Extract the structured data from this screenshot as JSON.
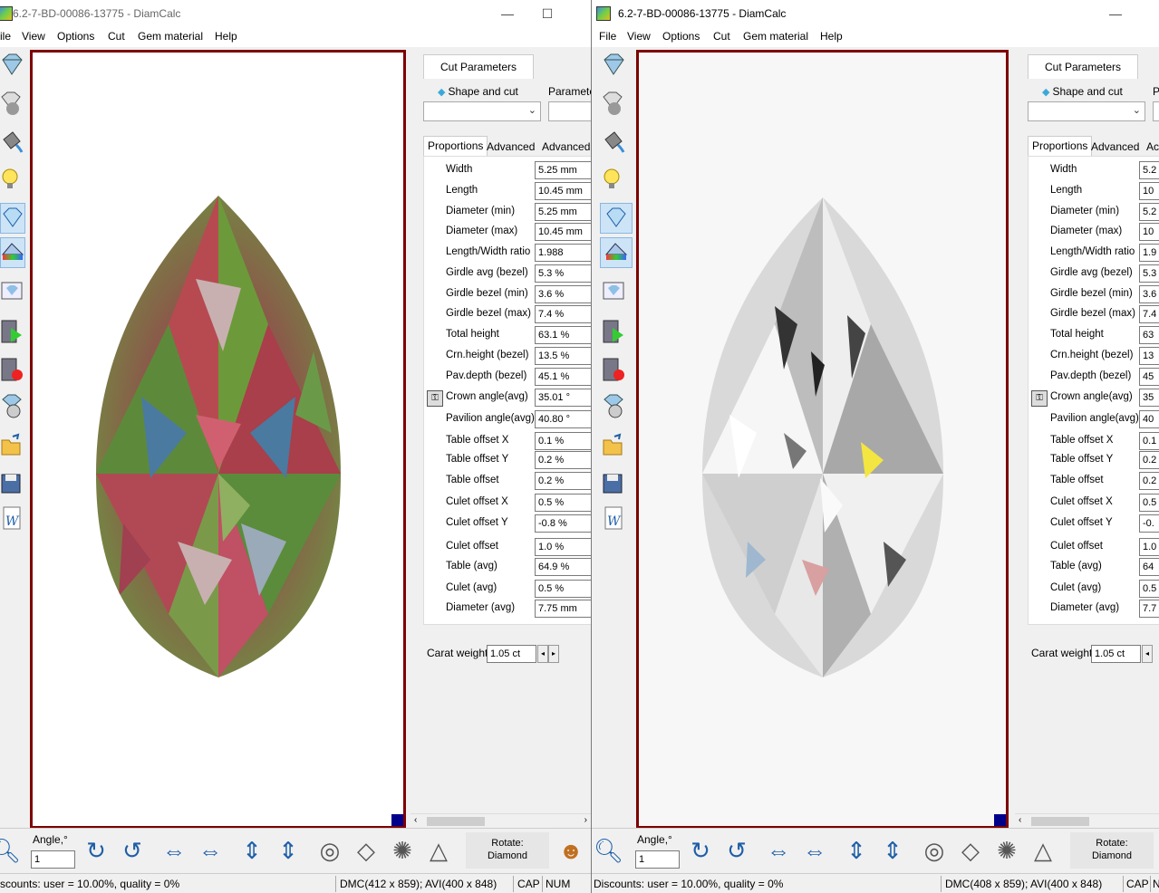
{
  "windows": [
    {
      "title": "6.2-7-BD-00086-13775 - DiamCalc",
      "menu": [
        "ile",
        "View",
        "Options",
        "Cut",
        "Gem material",
        "Help"
      ],
      "controls": [
        "—",
        "☐"
      ],
      "panel": {
        "tab": "Cut Parameters",
        "shape_label": "Shape and cut",
        "param_label": "Parameter",
        "subtabs": [
          "Proportions",
          "Advanced",
          "Advanced"
        ],
        "proportions": [
          {
            "label": "Width",
            "value": "5.25 mm"
          },
          {
            "label": "Length",
            "value": "10.45 mm"
          },
          {
            "label": "Diameter (min)",
            "value": "5.25 mm"
          },
          {
            "label": "Diameter (max)",
            "value": "10.45 mm"
          },
          {
            "label": "Length/Width ratio",
            "value": "1.988"
          },
          {
            "label": "Girdle avg (bezel)",
            "value": "5.3 %"
          },
          {
            "label": "Girdle bezel (min)",
            "value": "3.6 %"
          },
          {
            "label": "Girdle bezel (max)",
            "value": "7.4 %"
          },
          {
            "label": "Total height",
            "value": "63.1 %"
          },
          {
            "label": "Crn.height (bezel)",
            "value": "13.5 %"
          },
          {
            "label": "Pav.depth (bezel)",
            "value": "45.1 %"
          },
          {
            "label": "Crown angle(avg)",
            "value": "35.01 °"
          },
          {
            "label": "Pavilion angle(avg)",
            "value": "40.80 °"
          },
          {
            "label": "Table offset X",
            "value": "0.1 %"
          },
          {
            "label": "Table offset Y",
            "value": "0.2 %"
          },
          {
            "label": "Table offset",
            "value": "0.2 %"
          },
          {
            "label": "Culet offset X",
            "value": "0.5 %"
          },
          {
            "label": "Culet offset Y",
            "value": "-0.8 %"
          },
          {
            "label": "Culet offset",
            "value": "1.0 %"
          },
          {
            "label": "Table (avg)",
            "value": "64.9 %"
          },
          {
            "label": "Culet (avg)",
            "value": "0.5 %"
          },
          {
            "label": "Diameter (avg)",
            "value": "7.75 mm"
          }
        ],
        "carat_label": "Carat weight",
        "carat_value": "1.05 ct"
      },
      "bottom": {
        "angle_label": "Angle,°",
        "angle_value": "1",
        "rotate_label": "Rotate:",
        "rotate_value": "Diamond"
      },
      "status": {
        "discounts": "scounts: user = 10.00%, quality = 0%",
        "dims": "DMC(412 x 859); AVI(400 x 848)",
        "cap": "CAP",
        "num": "NUM"
      }
    },
    {
      "title": "6.2-7-BD-00086-13775 - DiamCalc",
      "menu": [
        "File",
        "View",
        "Options",
        "Cut",
        "Gem material",
        "Help"
      ],
      "controls": [
        "—"
      ],
      "panel": {
        "tab": "Cut Parameters",
        "shape_label": "Shape and cut",
        "param_label": "P",
        "subtabs": [
          "Proportions",
          "Advanced",
          "Ac"
        ],
        "proportions": [
          {
            "label": "Width",
            "value": "5.2"
          },
          {
            "label": "Length",
            "value": "10"
          },
          {
            "label": "Diameter (min)",
            "value": "5.2"
          },
          {
            "label": "Diameter (max)",
            "value": "10"
          },
          {
            "label": "Length/Width ratio",
            "value": "1.9"
          },
          {
            "label": "Girdle avg (bezel)",
            "value": "5.3"
          },
          {
            "label": "Girdle bezel (min)",
            "value": "3.6"
          },
          {
            "label": "Girdle bezel (max)",
            "value": "7.4"
          },
          {
            "label": "Total height",
            "value": "63"
          },
          {
            "label": "Crn.height (bezel)",
            "value": "13"
          },
          {
            "label": "Pav.depth (bezel)",
            "value": "45"
          },
          {
            "label": "Crown angle(avg)",
            "value": "35"
          },
          {
            "label": "Pavilion angle(avg)",
            "value": "40"
          },
          {
            "label": "Table offset X",
            "value": "0.1"
          },
          {
            "label": "Table offset Y",
            "value": "0.2"
          },
          {
            "label": "Table offset",
            "value": "0.2"
          },
          {
            "label": "Culet offset X",
            "value": "0.5"
          },
          {
            "label": "Culet offset Y",
            "value": "-0."
          },
          {
            "label": "Culet offset",
            "value": "1.0"
          },
          {
            "label": "Table (avg)",
            "value": "64"
          },
          {
            "label": "Culet (avg)",
            "value": "0.5"
          },
          {
            "label": "Diameter (avg)",
            "value": "7.7"
          }
        ],
        "carat_label": "Carat weight",
        "carat_value": "1.05 ct"
      },
      "bottom": {
        "angle_label": "Angle,°",
        "angle_value": "1",
        "rotate_label": "Rotate:",
        "rotate_value": "Diamond"
      },
      "status": {
        "discounts": "Discounts: user = 10.00%, quality = 0%",
        "dims": "DMC(408 x 859); AVI(400 x 848)",
        "cap": "CAP",
        "num": "N"
      }
    }
  ],
  "colors": {
    "viewport_border": "#7d0000",
    "corner_marker": "#00008b",
    "selected_tool": "#cde4f7"
  }
}
